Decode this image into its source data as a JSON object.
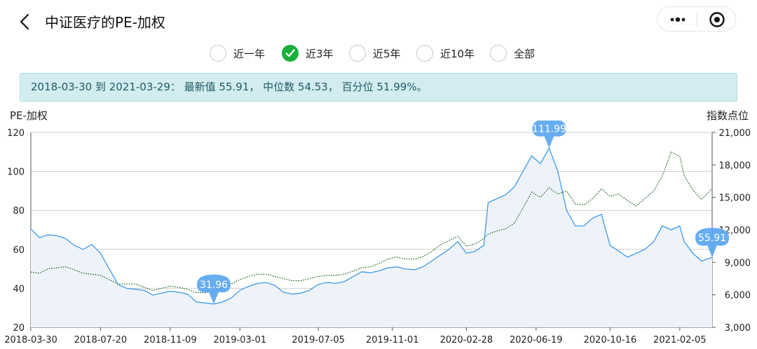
{
  "header": {
    "title": "中证医疗的PE-加权",
    "back_icon": "chevron-left-icon",
    "more_icon": "more-dots-icon",
    "target_icon": "target-icon"
  },
  "ranges": [
    {
      "label": "近一年",
      "checked": false
    },
    {
      "label": "近3年",
      "checked": true
    },
    {
      "label": "近5年",
      "checked": false
    },
    {
      "label": "近10年",
      "checked": false
    },
    {
      "label": "全部",
      "checked": false
    }
  ],
  "summary": "2018-03-30 到 2021-03-29： 最新值 55.91， 中位数 54.53， 百分位 51.99%。",
  "colors": {
    "pe_line": "#3d9be9",
    "pe_fill": "#eef3fa",
    "index_line": "#1a5c1a",
    "marker": "#5aa6f0",
    "grid": "#cfcfcf",
    "radio_checked": "#18b03a"
  },
  "chart_data": {
    "type": "line",
    "y_left_label": "PE-加权",
    "y_right_label": "指数点位",
    "y_left_range": [
      20,
      120
    ],
    "y_left_ticks": [
      "20",
      "40",
      "60",
      "80",
      "100",
      "120"
    ],
    "y_right_range": [
      3000,
      21000
    ],
    "y_right_ticks": [
      "3,000",
      "6,000",
      "9,000",
      "12,000",
      "15,000",
      "18,000",
      "21,000"
    ],
    "x_range": [
      "2018-03-30",
      "2021-03-29"
    ],
    "x_ticks": [
      "2018-03-30",
      "2018-07-20",
      "2018-11-09",
      "2019-03-01",
      "2019-07-05",
      "2019-11-01",
      "2020-02-28",
      "2020-06-19",
      "2020-10-16",
      "2021-02-05"
    ],
    "grid": true,
    "series": [
      {
        "axis": "left",
        "style": "solid-area",
        "points": [
          [
            "2018-03-30",
            70.5
          ],
          [
            "2018-04-13",
            66
          ],
          [
            "2018-04-27",
            67.5
          ],
          [
            "2018-05-11",
            67
          ],
          [
            "2018-05-25",
            65.5
          ],
          [
            "2018-06-08",
            62
          ],
          [
            "2018-06-22",
            60
          ],
          [
            "2018-07-06",
            62.5
          ],
          [
            "2018-07-20",
            58
          ],
          [
            "2018-08-03",
            50
          ],
          [
            "2018-08-17",
            42
          ],
          [
            "2018-08-31",
            40
          ],
          [
            "2018-09-14",
            39.5
          ],
          [
            "2018-09-28",
            39
          ],
          [
            "2018-10-12",
            36.5
          ],
          [
            "2018-10-26",
            37.5
          ],
          [
            "2018-11-09",
            38.5
          ],
          [
            "2018-11-23",
            38
          ],
          [
            "2018-12-07",
            37
          ],
          [
            "2018-12-21",
            33
          ],
          [
            "2019-01-04",
            32.5
          ],
          [
            "2019-01-18",
            31.96
          ],
          [
            "2019-02-01",
            33
          ],
          [
            "2019-02-15",
            35
          ],
          [
            "2019-03-01",
            39
          ],
          [
            "2019-03-15",
            41
          ],
          [
            "2019-03-29",
            42.5
          ],
          [
            "2019-04-12",
            43
          ],
          [
            "2019-04-26",
            41.5
          ],
          [
            "2019-05-10",
            38
          ],
          [
            "2019-05-24",
            37
          ],
          [
            "2019-06-07",
            37.5
          ],
          [
            "2019-06-21",
            39
          ],
          [
            "2019-07-05",
            42
          ],
          [
            "2019-07-19",
            43
          ],
          [
            "2019-08-02",
            42.5
          ],
          [
            "2019-08-16",
            43.5
          ],
          [
            "2019-08-30",
            46
          ],
          [
            "2019-09-13",
            48.5
          ],
          [
            "2019-09-27",
            48
          ],
          [
            "2019-10-11",
            49
          ],
          [
            "2019-10-25",
            50.5
          ],
          [
            "2019-11-08",
            51
          ],
          [
            "2019-11-22",
            50
          ],
          [
            "2019-12-06",
            49.5
          ],
          [
            "2019-12-20",
            51
          ],
          [
            "2020-01-03",
            54
          ],
          [
            "2020-01-17",
            57
          ],
          [
            "2020-01-31",
            60
          ],
          [
            "2020-02-14",
            64
          ],
          [
            "2020-02-28",
            58
          ],
          [
            "2020-03-13",
            59
          ],
          [
            "2020-03-27",
            62
          ],
          [
            "2020-04-03",
            84
          ],
          [
            "2020-04-17",
            86
          ],
          [
            "2020-05-01",
            88
          ],
          [
            "2020-05-15",
            92
          ],
          [
            "2020-05-29",
            100
          ],
          [
            "2020-06-12",
            108
          ],
          [
            "2020-06-26",
            104
          ],
          [
            "2020-07-10",
            111.99
          ],
          [
            "2020-07-24",
            100
          ],
          [
            "2020-08-07",
            80
          ],
          [
            "2020-08-21",
            72
          ],
          [
            "2020-09-04",
            72
          ],
          [
            "2020-09-18",
            76
          ],
          [
            "2020-10-02",
            78
          ],
          [
            "2020-10-16",
            62
          ],
          [
            "2020-10-30",
            59
          ],
          [
            "2020-11-13",
            56
          ],
          [
            "2020-11-27",
            58
          ],
          [
            "2020-12-11",
            60
          ],
          [
            "2020-12-25",
            64
          ],
          [
            "2021-01-08",
            72
          ],
          [
            "2021-01-22",
            70
          ],
          [
            "2021-02-05",
            72
          ],
          [
            "2021-02-12",
            64
          ],
          [
            "2021-02-26",
            58
          ],
          [
            "2021-03-12",
            54
          ],
          [
            "2021-03-29",
            55.91
          ]
        ]
      },
      {
        "axis": "right",
        "style": "dotted",
        "points": [
          [
            "2018-03-30",
            8100
          ],
          [
            "2018-04-13",
            8000
          ],
          [
            "2018-04-27",
            8400
          ],
          [
            "2018-05-11",
            8500
          ],
          [
            "2018-05-25",
            8600
          ],
          [
            "2018-06-08",
            8300
          ],
          [
            "2018-06-22",
            8000
          ],
          [
            "2018-07-06",
            7900
          ],
          [
            "2018-07-20",
            7800
          ],
          [
            "2018-08-03",
            7400
          ],
          [
            "2018-08-17",
            7000
          ],
          [
            "2018-08-31",
            7000
          ],
          [
            "2018-09-14",
            7000
          ],
          [
            "2018-09-28",
            6700
          ],
          [
            "2018-10-12",
            6400
          ],
          [
            "2018-10-26",
            6600
          ],
          [
            "2018-11-09",
            6800
          ],
          [
            "2018-11-23",
            6700
          ],
          [
            "2018-12-07",
            6500
          ],
          [
            "2018-12-21",
            6200
          ],
          [
            "2019-01-04",
            6200
          ],
          [
            "2019-01-18",
            6300
          ],
          [
            "2019-02-01",
            6600
          ],
          [
            "2019-02-15",
            7000
          ],
          [
            "2019-03-01",
            7400
          ],
          [
            "2019-03-15",
            7700
          ],
          [
            "2019-03-29",
            7900
          ],
          [
            "2019-04-12",
            7900
          ],
          [
            "2019-04-26",
            7700
          ],
          [
            "2019-05-10",
            7500
          ],
          [
            "2019-05-24",
            7300
          ],
          [
            "2019-06-07",
            7300
          ],
          [
            "2019-06-21",
            7500
          ],
          [
            "2019-07-05",
            7700
          ],
          [
            "2019-07-19",
            7800
          ],
          [
            "2019-08-02",
            7800
          ],
          [
            "2019-08-16",
            7900
          ],
          [
            "2019-08-30",
            8200
          ],
          [
            "2019-09-13",
            8500
          ],
          [
            "2019-09-27",
            8600
          ],
          [
            "2019-10-11",
            8900
          ],
          [
            "2019-10-25",
            9300
          ],
          [
            "2019-11-08",
            9500
          ],
          [
            "2019-11-22",
            9300
          ],
          [
            "2019-12-06",
            9300
          ],
          [
            "2019-12-20",
            9500
          ],
          [
            "2020-01-03",
            10000
          ],
          [
            "2020-01-17",
            10600
          ],
          [
            "2020-01-31",
            11000
          ],
          [
            "2020-02-14",
            11400
          ],
          [
            "2020-02-28",
            10500
          ],
          [
            "2020-03-13",
            10700
          ],
          [
            "2020-03-27",
            11200
          ],
          [
            "2020-04-03",
            11600
          ],
          [
            "2020-04-17",
            11900
          ],
          [
            "2020-05-01",
            12100
          ],
          [
            "2020-05-15",
            12600
          ],
          [
            "2020-05-29",
            14000
          ],
          [
            "2020-06-12",
            15500
          ],
          [
            "2020-06-26",
            15000
          ],
          [
            "2020-07-10",
            15900
          ],
          [
            "2020-07-24",
            15300
          ],
          [
            "2020-08-07",
            15600
          ],
          [
            "2020-08-21",
            14400
          ],
          [
            "2020-09-04",
            14300
          ],
          [
            "2020-09-18",
            14900
          ],
          [
            "2020-10-02",
            15800
          ],
          [
            "2020-10-16",
            15100
          ],
          [
            "2020-10-30",
            15300
          ],
          [
            "2020-11-13",
            14700
          ],
          [
            "2020-11-27",
            14200
          ],
          [
            "2020-12-11",
            14900
          ],
          [
            "2020-12-25",
            15600
          ],
          [
            "2021-01-08",
            17000
          ],
          [
            "2021-01-22",
            19200
          ],
          [
            "2021-02-05",
            18800
          ],
          [
            "2021-02-12",
            17000
          ],
          [
            "2021-02-26",
            15700
          ],
          [
            "2021-03-12",
            14800
          ],
          [
            "2021-03-29",
            15800
          ]
        ]
      }
    ],
    "annotations": [
      {
        "date": "2019-01-18",
        "value": 31.96,
        "text": "31.96"
      },
      {
        "date": "2020-07-10",
        "value": 111.99,
        "text": "111.99"
      },
      {
        "date": "2021-03-29",
        "value": 55.91,
        "text": "55.91"
      }
    ]
  }
}
